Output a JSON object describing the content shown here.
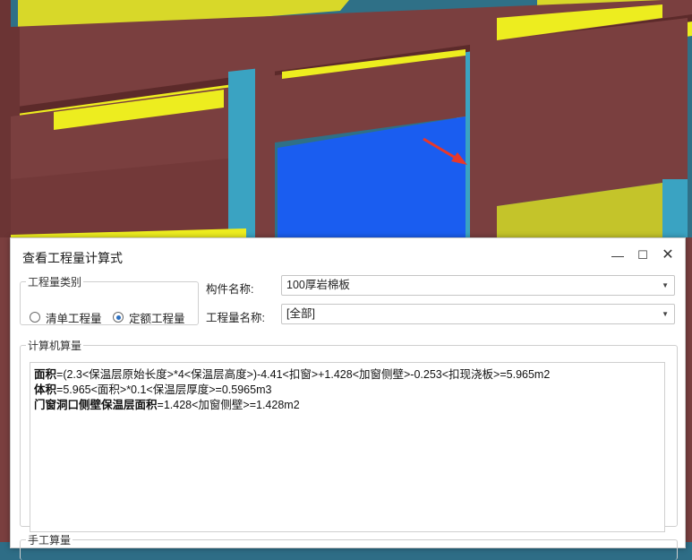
{
  "dialog": {
    "title": "查看工程量计算式",
    "minimize_label": "—",
    "maximize_label": "☐",
    "close_label": "✕"
  },
  "quantity_type": {
    "legend": "工程量类别",
    "options": [
      {
        "label": "清单工程量",
        "selected": false
      },
      {
        "label": "定额工程量",
        "selected": true
      }
    ]
  },
  "component_name": {
    "label": "构件名称:",
    "value": "100厚岩棉板"
  },
  "quantity_name": {
    "label": "工程量名称:",
    "value": "[全部]"
  },
  "computer_calc": {
    "legend": "计算机算量",
    "lines": [
      {
        "name": "面积",
        "expr": "=(2.3<保温层原始长度>*4<保温层高度>)-4.41<扣窗>+1.428<加窗侧壁>-0.253<扣现浇板>=5.965m2"
      },
      {
        "name": "体积",
        "expr": "=5.965<面积>*0.1<保温层厚度>=0.5965m3"
      },
      {
        "name": "门窗洞口侧壁保温层面积",
        "expr": "=1.428<加窗侧壁>=1.428m2"
      }
    ]
  },
  "manual_calc": {
    "legend": "手工算量"
  },
  "colors": {
    "beam": "#7a3f3f",
    "insulation_yellow": "#eded1f",
    "opening_blue": "#1a5df0",
    "column_teal": "#3aa3c2",
    "arrow_red": "#e8382b"
  }
}
